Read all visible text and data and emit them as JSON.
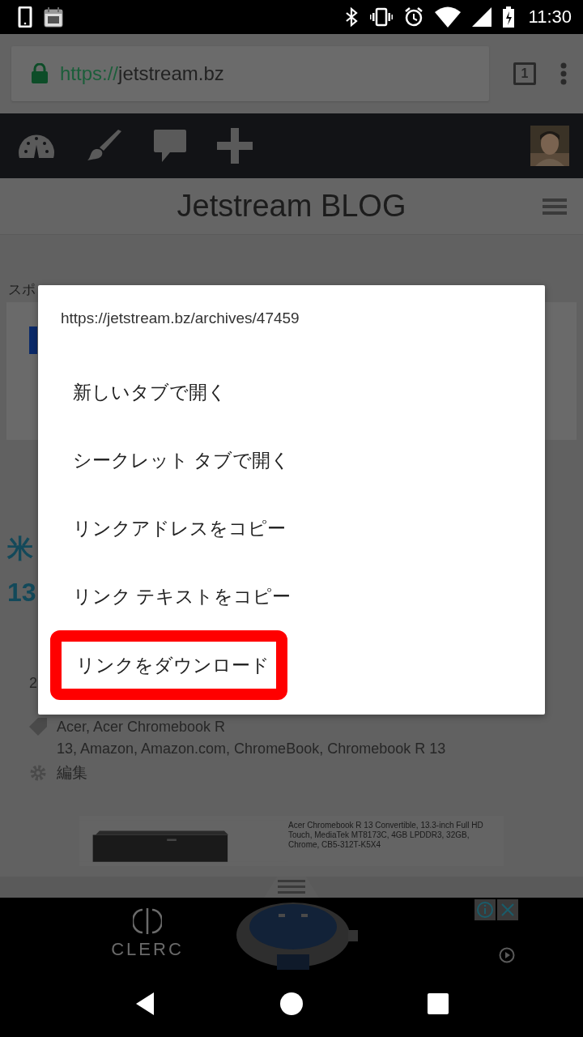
{
  "status_bar": {
    "time": "11:30"
  },
  "browser": {
    "url_scheme": "https://",
    "url_host": "jetstream.bz",
    "tab_count": "1"
  },
  "site": {
    "title": "Jetstream BLOG"
  },
  "background": {
    "sponsor_label": "スポ",
    "heading_fragments": [
      "米",
      "13"
    ],
    "date_fragment": "2",
    "tags_line_1": "Acer, Acer Chromebook R",
    "tags_line_2": "13, Amazon, Amazon.com, ChromeBook, Chromebook R 13",
    "edit_link": "編集",
    "product_title": "Acer Chromebook R 13 Convertible, 13.3-inch Full HD Touch, MediaTek MT8173C, 4GB LPDDR3, 32GB, Chrome, CB5-312T-K5X4",
    "banner_brand": "CLERC"
  },
  "context_menu": {
    "url": "https://jetstream.bz/archives/47459",
    "items": [
      {
        "label": "新しいタブで開く",
        "highlighted": false
      },
      {
        "label": "シークレット タブで開く",
        "highlighted": false
      },
      {
        "label": "リンクアドレスをコピー",
        "highlighted": false
      },
      {
        "label": "リンク テキストをコピー",
        "highlighted": false
      },
      {
        "label": "リンクをダウンロード",
        "highlighted": true
      }
    ]
  }
}
